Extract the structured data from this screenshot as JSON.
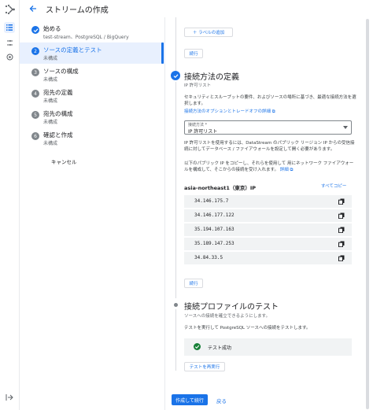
{
  "header": {
    "title": "ストリームの作成"
  },
  "steps": [
    {
      "num": "✓",
      "title": "始める",
      "subtitle": "test-stream、PostgreSQL / BigQuery",
      "state": "done"
    },
    {
      "num": "2",
      "title": "ソースの定義とテスト",
      "subtitle": "未構成",
      "state": "active"
    },
    {
      "num": "3",
      "title": "ソースの構成",
      "subtitle": "未構成",
      "state": "todo"
    },
    {
      "num": "4",
      "title": "宛先の定義",
      "subtitle": "未構成",
      "state": "todo"
    },
    {
      "num": "5",
      "title": "宛先の構成",
      "subtitle": "未構成",
      "state": "todo"
    },
    {
      "num": "6",
      "title": "確認と作成",
      "subtitle": "未構成",
      "state": "todo"
    }
  ],
  "cancel_label": "キャンセル",
  "main": {
    "add_label": "＋ ラベルの追加",
    "continue_label": "続行",
    "connect": {
      "title": "接続方法の定義",
      "subtitle": "IP 許可リスト",
      "desc": "セキュリティとスループットの要件、およびソースの場所に基づき、最適な接続方法を選択します。",
      "options_link": "接続方法のオプションとトレードオフの詳細",
      "select_label": "接続方法 *",
      "select_value": "IP 許可リスト",
      "para1": "IP 許可リストを使用するには、DataStream のパブリック リージョン IP からの受信接続に対してデータベース / ファイアウォールを設定して開く必要があります。",
      "para2_pre": "以下のパブリック IP をコピーし、それらを使用して 用にネットワーク ファイアウォールを構成して、そこからの接続を受け入れます。",
      "para2_link": "詳細",
      "region": "asia-northeast1（東京）IP",
      "copy_all": "すべてコピー",
      "ips": [
        "34.146.175.7",
        "34.146.177.122",
        "35.194.107.163",
        "35.189.147.253",
        "34.84.33.5"
      ],
      "continue_label": "続行"
    },
    "profile": {
      "title": "接続プロファイルのテスト",
      "subtitle": "ソースへの接続を確立できるようにします。",
      "desc": "テストを実行して PostgreSQL ソースへの接続をテストします。",
      "result": "テスト成功",
      "rerun_label": "テストを再実行"
    },
    "create_label": "作成して続行",
    "back_label": "戻る"
  },
  "colors": {
    "accent": "#1a73e8",
    "success": "#188038"
  }
}
